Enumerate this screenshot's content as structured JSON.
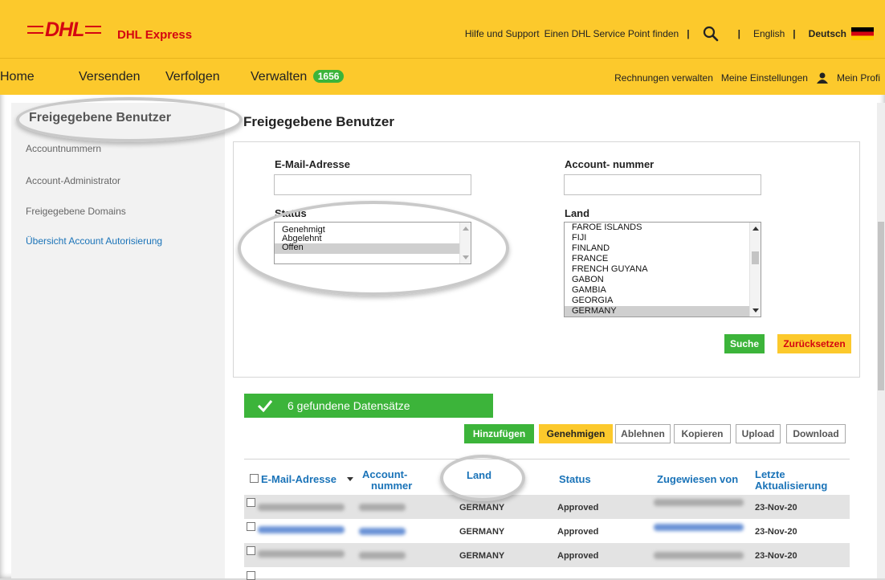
{
  "header": {
    "brand": "DHL Express",
    "logo_text": "DHL",
    "help": "Hilfe und Support",
    "service_point": "Einen DHL Service Point finden",
    "sep": "|",
    "lang_en": "English",
    "lang_de": "Deutsch"
  },
  "nav": {
    "home": "Home",
    "send": "Versenden",
    "track": "Verfolgen",
    "manage": "Verwalten",
    "manage_badge": "1656",
    "invoices": "Rechnungen verwalten",
    "settings": "Meine Einstellungen",
    "profile": "Mein Profi"
  },
  "sidebar": {
    "title": "Freigegebene Benutzer",
    "items": [
      "Accountnummern",
      "Account-Administrator",
      "Freigegebene Domains",
      "Übersicht Account Autorisierung"
    ]
  },
  "main": {
    "title": "Freigegebene Benutzer",
    "email_label": "E-Mail-Adresse",
    "account_label": "Account- nummer",
    "status_label": "Status",
    "country_label": "Land",
    "status_options": [
      "Genehmigt",
      "Abgelehnt",
      "Offen"
    ],
    "status_selected": "Offen",
    "country_options": [
      "FAROE ISLANDS",
      "FIJI",
      "FINLAND",
      "FRANCE",
      "FRENCH GUYANA",
      "GABON",
      "GAMBIA",
      "GEORGIA",
      "GERMANY"
    ],
    "country_selected": "GERMANY",
    "search_btn": "Suche",
    "reset_btn": "Zurücksetzen"
  },
  "results": {
    "count_text": "6  gefundene Datensätze",
    "actions": {
      "add": "Hinzufügen",
      "approve": "Genehmigen",
      "reject": "Ablehnen",
      "copy": "Kopieren",
      "upload": "Upload",
      "download": "Download"
    },
    "columns": {
      "email": "E-Mail-Adresse",
      "account_1": "Account-",
      "account_2": "nummer",
      "country": "Land",
      "status": "Status",
      "assigned": "Zugewiesen von",
      "updated_1": "Letzte",
      "updated_2": "Aktualisierung"
    },
    "rows": [
      {
        "country": "GERMANY",
        "status": "Approved",
        "date": "23-Nov-20"
      },
      {
        "country": "GERMANY",
        "status": "Approved",
        "date": "23-Nov-20"
      },
      {
        "country": "GERMANY",
        "status": "Approved",
        "date": "23-Nov-20"
      }
    ]
  }
}
